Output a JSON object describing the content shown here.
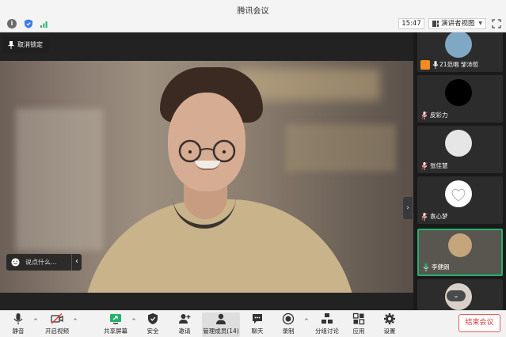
{
  "window": {
    "title": "腾讯会议",
    "time": "15:47",
    "view_mode": "演讲者视图"
  },
  "main": {
    "unpin_label": "取消锁定",
    "chat_placeholder": "说点什么..."
  },
  "participants": [
    {
      "name": "21范唱 邹沛哲",
      "avatar_color": "#7fa8c4",
      "host": true
    },
    {
      "name": "皮彩力",
      "avatar_color": "#000000",
      "host": false
    },
    {
      "name": "张佳慧",
      "avatar_color": "#e6e6e6",
      "host": false
    },
    {
      "name": "袁心梦",
      "avatar_color": "#ffffff",
      "host": false
    },
    {
      "name": "李健朗",
      "avatar_color": "#c4a57c",
      "host": false,
      "active": true
    }
  ],
  "toolbar": {
    "mute": "静音",
    "start_video": "开启视频",
    "share_screen": "共享屏幕",
    "security": "安全",
    "invite": "邀请",
    "manage_members": "管理成员(14)",
    "chat": "聊天",
    "record": "录制",
    "breakout": "分组讨论",
    "apps": "应用",
    "settings": "设置",
    "end_meeting": "结束会议"
  },
  "colors": {
    "accent_green": "#23b26d",
    "end_red": "#e0393b",
    "host_orange": "#f08c21"
  }
}
